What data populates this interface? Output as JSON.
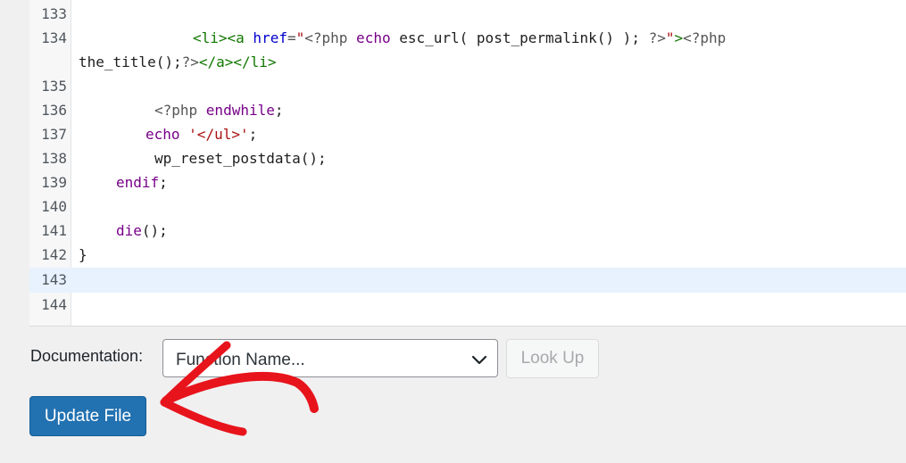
{
  "editor": {
    "lines": [
      {
        "num": "133"
      },
      {
        "num": "134"
      },
      {
        "num": "135"
      },
      {
        "num": "136"
      },
      {
        "num": "137"
      },
      {
        "num": "138"
      },
      {
        "num": "139"
      },
      {
        "num": "140"
      },
      {
        "num": "141"
      },
      {
        "num": "142"
      },
      {
        "num": "143"
      },
      {
        "num": "144"
      }
    ],
    "code": {
      "l134_li_open": "<li>",
      "l134_a_open": "<a",
      "l134_href": " href",
      "l134_eq": "=",
      "l134_q1": "\"",
      "l134_php1": "<?php",
      "l134_echo": " echo",
      "l134_call": " esc_url( post_permalink() ); ",
      "l134_close1": "?>",
      "l134_q2": "\"",
      "l134_gt": ">",
      "l134_php2": "<?php",
      "l134b_call": "the_title();",
      "l134b_close": "?>",
      "l134b_tags": "</a></li>",
      "l136_php": "<?php ",
      "l136_kw": "endwhile",
      "l136_semi": ";",
      "l137_kw": "echo",
      "l137_str": "'</ul>'",
      "l137_semi": ";",
      "l138": "wp_reset_postdata();",
      "l139_kw": "endif",
      "l139_semi": ";",
      "l141_kw": "die",
      "l141_rest": "();",
      "l142": "}"
    },
    "active_line": "143"
  },
  "documentation": {
    "label": "Documentation:",
    "select_value": "Function Name...",
    "lookup_label": "Look Up"
  },
  "actions": {
    "update_label": "Update File"
  },
  "colors": {
    "primary": "#2271b1",
    "arrow": "#e8141c",
    "keyword": "#770088",
    "tag": "#117700",
    "attribute": "#0000cc",
    "string": "#aa1111"
  }
}
